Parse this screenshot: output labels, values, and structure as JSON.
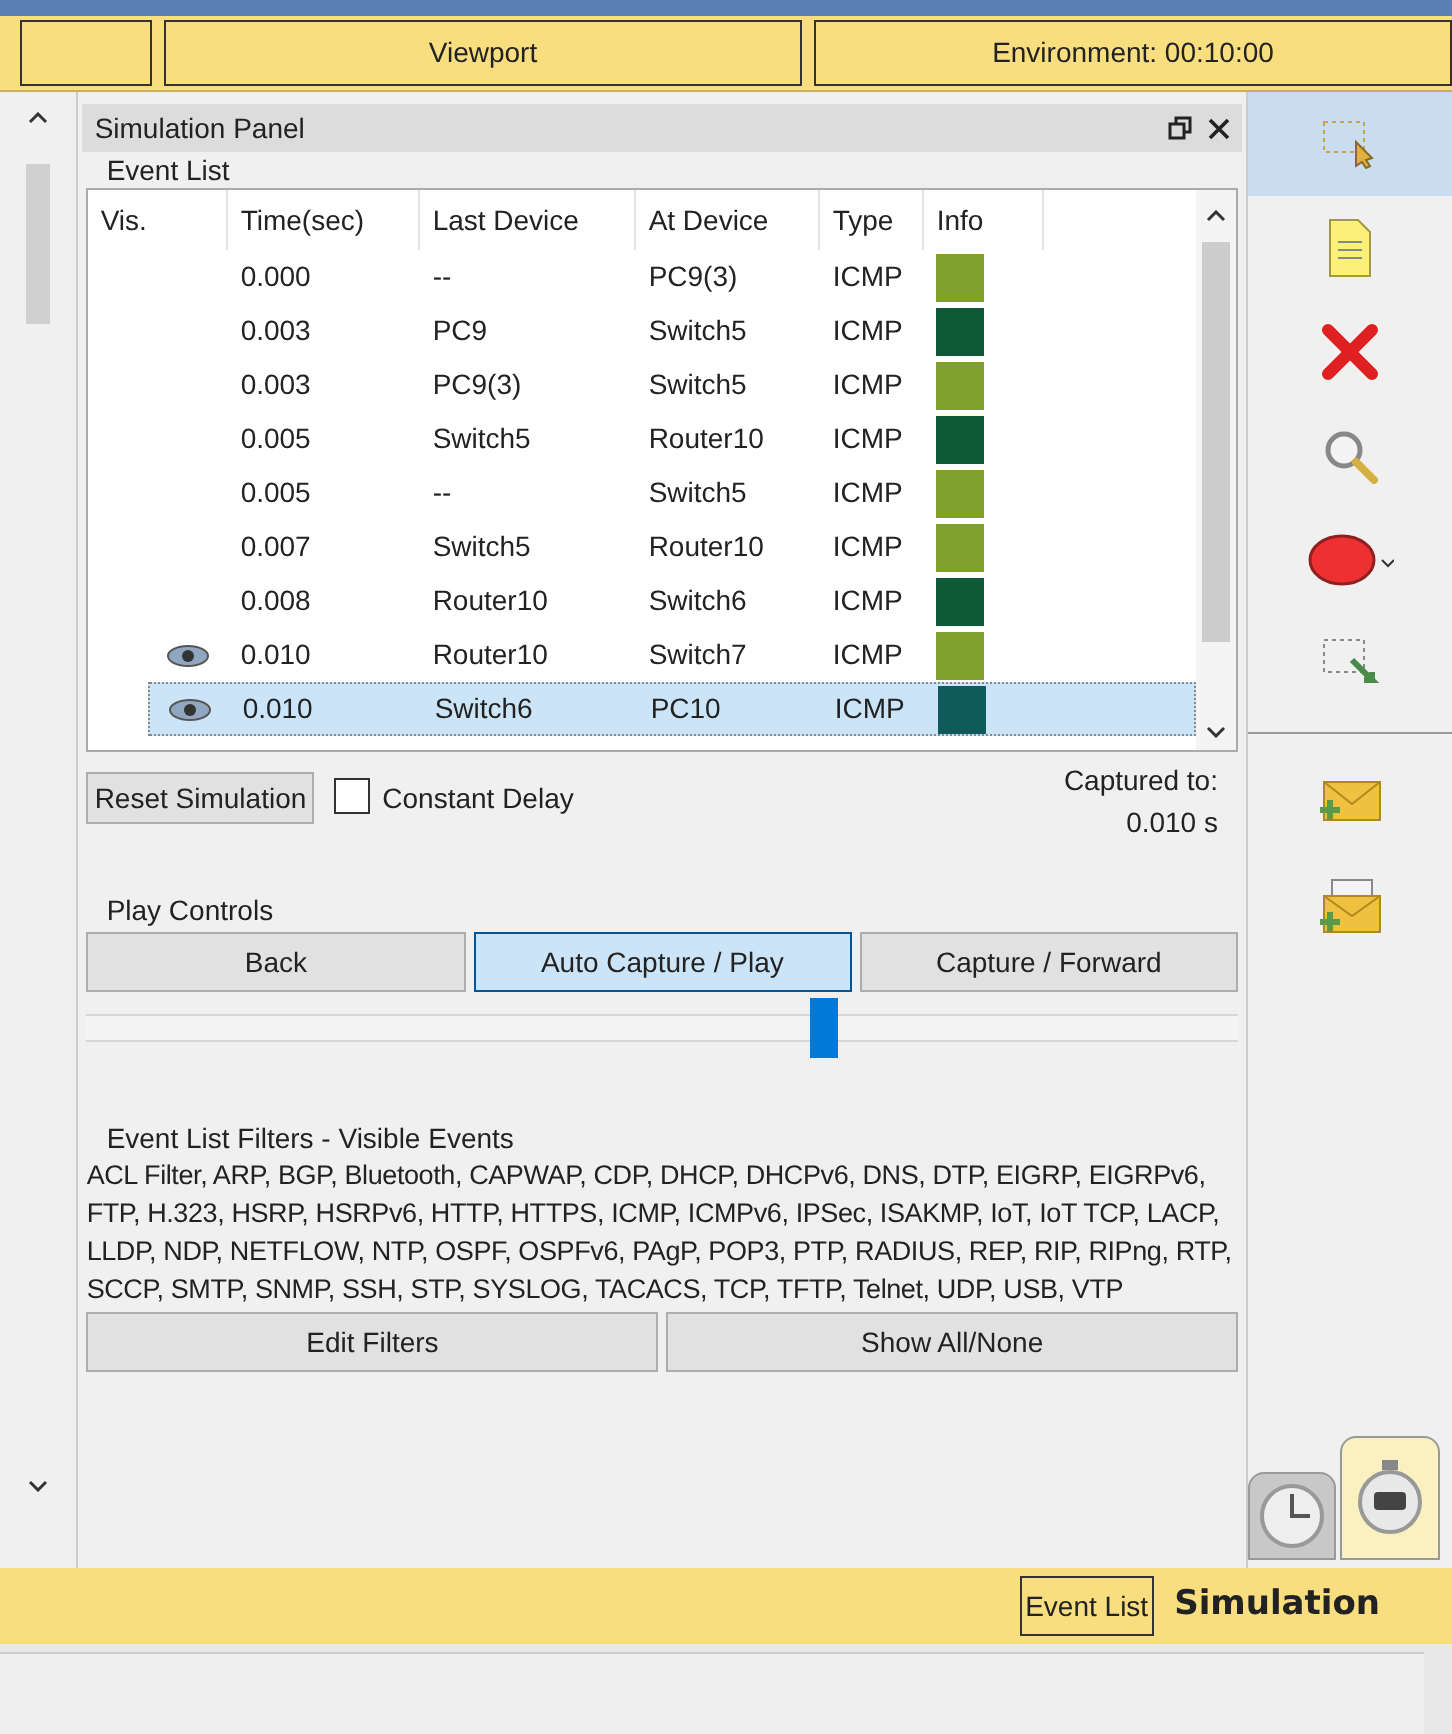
{
  "top_bar": {
    "tabs": [
      {
        "label": "Viewport"
      },
      {
        "label": "Environment: 00:10:00"
      }
    ]
  },
  "panel": {
    "title": "Simulation Panel",
    "event_list": {
      "title": "Event List",
      "columns": [
        "Vis.",
        "Time(sec)",
        "Last Device",
        "At Device",
        "Type",
        "Info"
      ],
      "rows": [
        {
          "visible": false,
          "selected": false,
          "time": "0.000",
          "last_device": "--",
          "at_device": "PC9(3)",
          "type": "ICMP",
          "color": "#7fa02a"
        },
        {
          "visible": false,
          "selected": false,
          "time": "0.003",
          "last_device": "PC9",
          "at_device": "Switch5",
          "type": "ICMP",
          "color": "#0f5a36"
        },
        {
          "visible": false,
          "selected": false,
          "time": "0.003",
          "last_device": "PC9(3)",
          "at_device": "Switch5",
          "type": "ICMP",
          "color": "#7fa02a"
        },
        {
          "visible": false,
          "selected": false,
          "time": "0.005",
          "last_device": "Switch5",
          "at_device": "Router10",
          "type": "ICMP",
          "color": "#0f5a36"
        },
        {
          "visible": false,
          "selected": false,
          "time": "0.005",
          "last_device": "--",
          "at_device": "Switch5",
          "type": "ICMP",
          "color": "#7fa02a"
        },
        {
          "visible": false,
          "selected": false,
          "time": "0.007",
          "last_device": "Switch5",
          "at_device": "Router10",
          "type": "ICMP",
          "color": "#7fa02a"
        },
        {
          "visible": false,
          "selected": false,
          "time": "0.008",
          "last_device": "Router10",
          "at_device": "Switch6",
          "type": "ICMP",
          "color": "#0f5a36"
        },
        {
          "visible": true,
          "selected": false,
          "time": "0.010",
          "last_device": "Router10",
          "at_device": "Switch7",
          "type": "ICMP",
          "color": "#7fa02a"
        },
        {
          "visible": true,
          "selected": true,
          "time": "0.010",
          "last_device": "Switch6",
          "at_device": "PC10",
          "type": "ICMP",
          "color": "#0f5a5a"
        }
      ]
    },
    "reset_button": "Reset Simulation",
    "constant_delay": {
      "label": "Constant Delay",
      "checked": false
    },
    "captured_label": "Captured to:",
    "captured_value": "0.010 s",
    "play_controls": {
      "title": "Play Controls",
      "buttons": [
        {
          "label": "Back",
          "selected": false
        },
        {
          "label": "Auto Capture / Play",
          "selected": true
        },
        {
          "label": "Capture / Forward",
          "selected": false
        }
      ],
      "slider": {
        "level": 0.64
      }
    },
    "filters": {
      "title": "Event List Filters - Visible Events",
      "text": "ACL Filter, ARP, BGP, Bluetooth, CAPWAP, CDP, DHCP, DHCPv6, DNS, DTP, EIGRP, EIGRPv6, FTP, H.323, HSRP, HSRPv6, HTTP, HTTPS, ICMP, ICMPv6, IPSec, ISAKMP, IoT, IoT TCP, LACP, LLDP, NDP, NETFLOW, NTP, OSPF, OSPFv6, PAgP, POP3, PTP, RADIUS, REP, RIP, RIPng, RTP, SCCP, SMTP, SNMP, SSH, STP, SYSLOG, TACACS, TCP, TFTP, Telnet, UDP, USB, VTP",
      "buttons": [
        "Edit Filters",
        "Show All/None"
      ]
    }
  },
  "toolbar": [
    {
      "kind": "select",
      "selected": true
    },
    {
      "kind": "note",
      "selected": false
    },
    {
      "kind": "delete",
      "selected": false
    },
    {
      "kind": "inspect",
      "selected": false
    },
    {
      "kind": "shape",
      "selected": false
    },
    {
      "kind": "resize",
      "selected": false
    },
    {
      "kind": "simple-pdu",
      "selected": false
    },
    {
      "kind": "complex-pdu",
      "selected": false
    }
  ],
  "modes": [
    {
      "kind": "realtime",
      "selected": false
    },
    {
      "kind": "simulation",
      "selected": true
    }
  ],
  "bottom_bar": {
    "event_list_button": "Event List",
    "mode_label": "Simulation"
  }
}
